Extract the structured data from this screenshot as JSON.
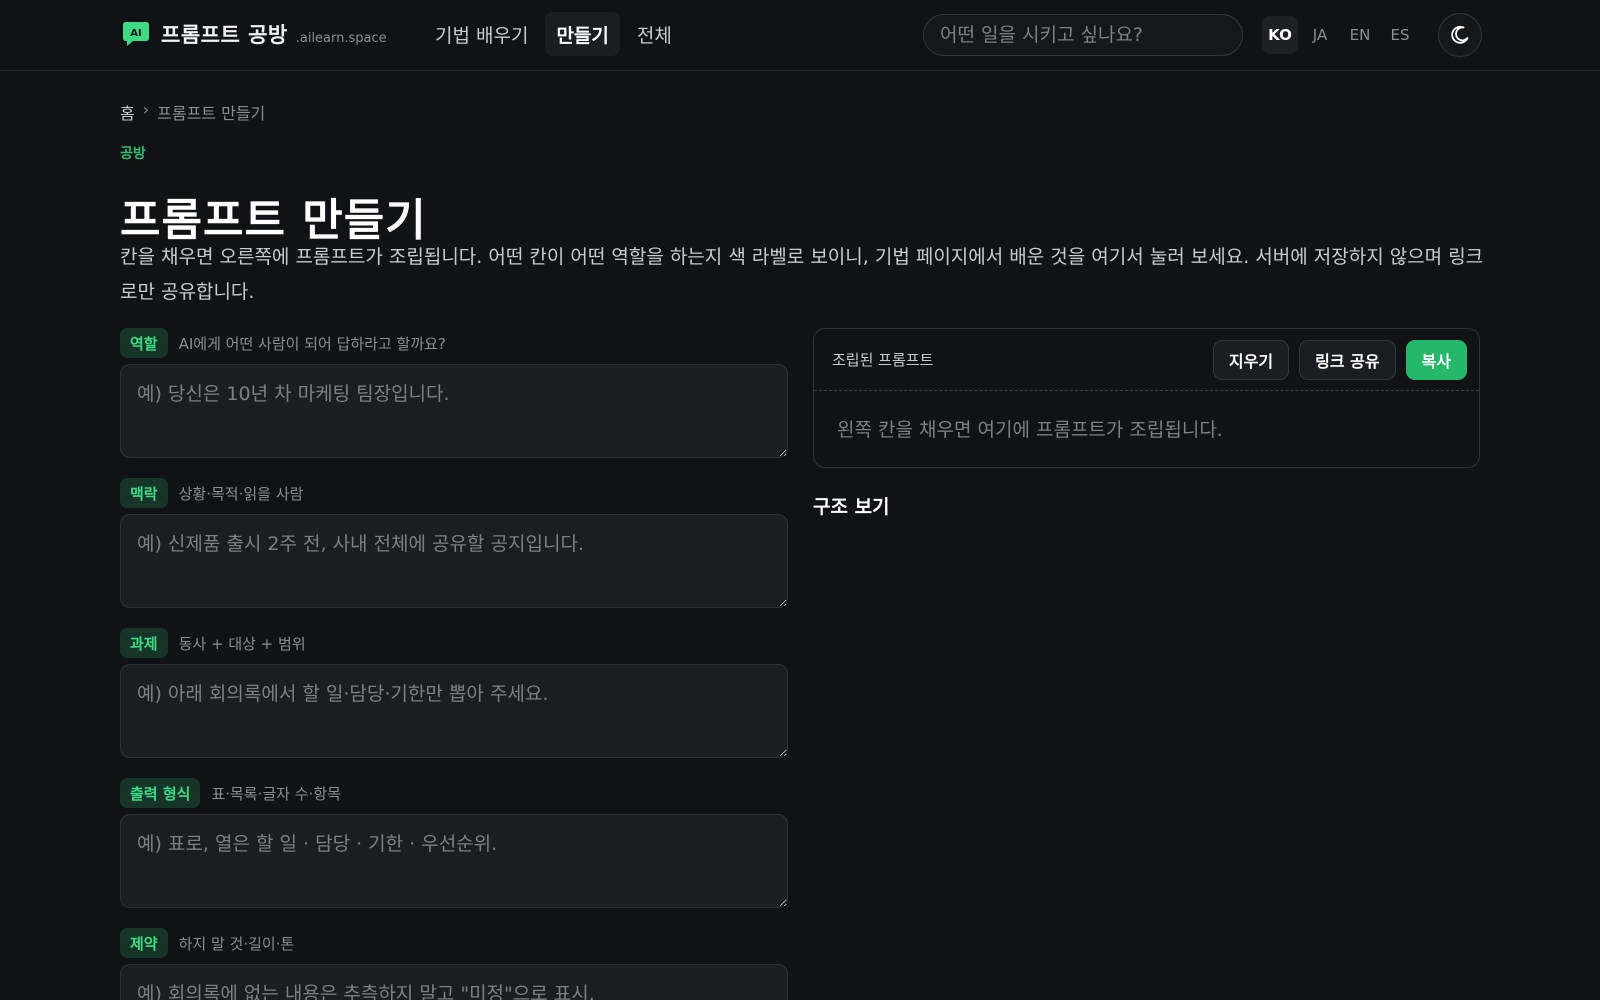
{
  "header": {
    "logo_badge": "AI",
    "title": "프롬프트 공방",
    "domain": ".ailearn.space",
    "nav": [
      {
        "label": "기법 배우기"
      },
      {
        "label": "만들기"
      },
      {
        "label": "전체"
      }
    ],
    "active_nav": "만들기",
    "search_placeholder": "어떤 일을 시키고 싶나요?",
    "languages": [
      "KO",
      "JA",
      "EN",
      "ES"
    ],
    "active_language": "KO",
    "theme_icon": "moon-icon"
  },
  "breadcrumb": {
    "home": "홈",
    "separator": "›",
    "current": "프롬프트 만들기"
  },
  "eyebrow": "공방",
  "page_title": "프롬프트 만들기",
  "lead": "칸을 채우면 오른쪽에 프롬프트가 조립됩니다. 어떤 칸이 어떤 역할을 하는지 색 라벨로 보이니, 기법 페이지에서 배운 것을 여기서 눌러 보세요. 서버에 저장하지 않으며 링크로만 공유합니다.",
  "fields": [
    {
      "tag": "역할",
      "hint": "AI에게 어떤 사람이 되어 답하라고 할까요?",
      "placeholder": "예) 당신은 10년 차 마케팅 팀장입니다."
    },
    {
      "tag": "맥락",
      "hint": "상황·목적·읽을 사람",
      "placeholder": "예) 신제품 출시 2주 전, 사내 전체에 공유할 공지입니다."
    },
    {
      "tag": "과제",
      "hint": "동사 + 대상 + 범위",
      "placeholder": "예) 아래 회의록에서 할 일·담당·기한만 뽑아 주세요."
    },
    {
      "tag": "출력 형식",
      "hint": "표·목록·글자 수·항목",
      "placeholder": "예) 표로, 열은 할 일 · 담당 · 기한 · 우선순위."
    },
    {
      "tag": "제약",
      "hint": "하지 말 것·길이·톤",
      "placeholder": "예) 회의록에 없는 내용은 추측하지 말고 \"미정\"으로 표시."
    }
  ],
  "panel": {
    "title": "조립된 프롬프트",
    "clear_label": "지우기",
    "share_label": "링크 공유",
    "copy_label": "복사",
    "empty_text": "왼쪽 칸을 채우면 여기에 프롬프트가 조립됩니다."
  },
  "structure_title": "구조 보기",
  "colors": {
    "background": "#111216",
    "accent": "#25b86a",
    "tag_bg": "#163427",
    "tag_text": "#3ddc84"
  }
}
